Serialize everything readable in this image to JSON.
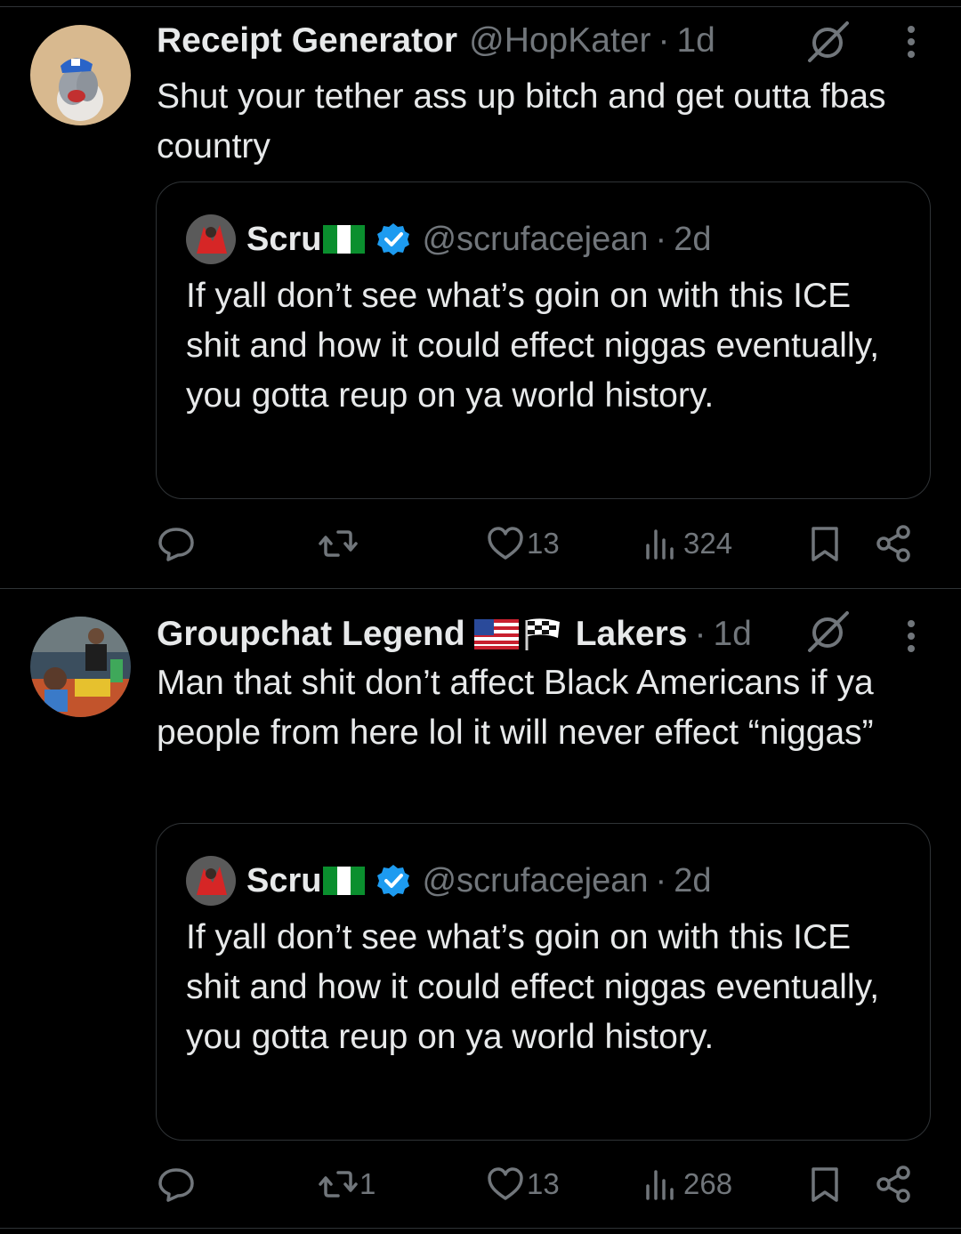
{
  "tweets": [
    {
      "name": "Receipt Generator",
      "handle": "@HopKater",
      "separator": "·",
      "time": "1d",
      "text": "Shut your tether ass up bitch and get outta fbas country",
      "quote": {
        "name": "Scru",
        "handle": "@scrufacejean",
        "separator": "·",
        "time": "2d",
        "text": "If yall don’t see what’s goin on with this ICE shit and how it could effect niggas eventually, you gotta reup on ya world history."
      },
      "actions": {
        "replies": "",
        "reposts": "",
        "likes": "13",
        "views": "324"
      }
    },
    {
      "name": "Groupchat Legend",
      "name_suffix": "Lakers",
      "handle": "",
      "separator": "·",
      "time": "1d",
      "text": "Man that shit don’t affect Black Americans if ya people from here lol it will never effect “niggas”",
      "quote": {
        "name": "Scru",
        "handle": "@scrufacejean",
        "separator": "·",
        "time": "2d",
        "text": "If yall don’t see what’s goin on with this ICE shit and how it could effect niggas eventually, you gotta reup on ya world history."
      },
      "actions": {
        "replies": "",
        "reposts": "1",
        "likes": "13",
        "views": "268"
      }
    }
  ],
  "colors": {
    "background": "#000000",
    "text": "#e7e9ea",
    "muted": "#71767b",
    "border": "#2f3336",
    "verified": "#1d9bf0"
  },
  "icons": [
    "reply-icon",
    "repost-icon",
    "like-icon",
    "views-icon",
    "bookmark-icon",
    "share-icon",
    "grok-icon",
    "more-icon",
    "verified-badge-icon"
  ]
}
